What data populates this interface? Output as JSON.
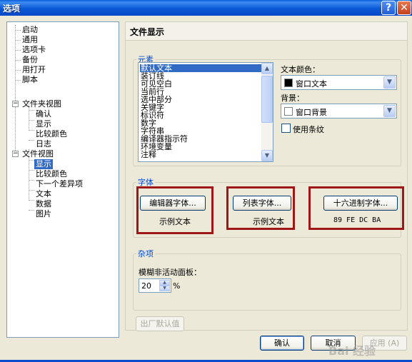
{
  "window": {
    "title": "选项",
    "help_glyph": "?",
    "close_glyph": "✕"
  },
  "tree": {
    "items": [
      {
        "label": "启动"
      },
      {
        "label": "通用"
      },
      {
        "label": "选项卡"
      },
      {
        "label": "备份"
      },
      {
        "label": "用打开"
      },
      {
        "label": "脚本"
      },
      {
        "label": "文件夹视图"
      },
      {
        "label": "确认"
      },
      {
        "label": "显示"
      },
      {
        "label": "比较颜色"
      },
      {
        "label": "日志"
      },
      {
        "label": "文件视图"
      },
      {
        "label": "显示"
      },
      {
        "label": "比较颜色"
      },
      {
        "label": "下一个差异项"
      },
      {
        "label": "文本"
      },
      {
        "label": "数据"
      },
      {
        "label": "图片"
      }
    ],
    "selected_index": 12,
    "expander_glyph": "−"
  },
  "panel": {
    "title": "文件显示"
  },
  "elements_group": {
    "legend": "元素",
    "list_items": [
      "默认文本",
      "装订线",
      "可见空白",
      "当前行",
      "选中部分",
      "关键字",
      "标识符",
      "数字",
      "字符串",
      "编译器指示符",
      "环境变量",
      "注释"
    ],
    "selected_index": 0,
    "text_color_label": "文本颜色：",
    "text_color_value": "窗口文本",
    "text_color_swatch": "#000000",
    "background_label": "背景：",
    "background_value": "窗口背景",
    "background_swatch": "#ffffff",
    "stripes_label": "使用条纹",
    "stripes_checked": false
  },
  "font_group": {
    "legend": "字体",
    "editor_font_button": "编辑器字体...",
    "editor_sample": "示例文本",
    "list_font_button": "列表字体...",
    "list_sample": "示例文本",
    "hex_font_button": "十六进制字体...",
    "hex_sample": "89 FE DC BA"
  },
  "misc_group": {
    "legend": "杂项",
    "fade_label": "模糊非活动面板：",
    "fade_value": "20",
    "fade_unit": "%"
  },
  "factory_defaults_button": "出厂默认值",
  "footer": {
    "ok": "确认",
    "cancel": "取消",
    "apply": "应用 (A)"
  },
  "watermark": "Bai 经验",
  "colors": {
    "highlight": "#316ac5",
    "annotation_red": "#a01717",
    "group_legend": "#0046d5"
  },
  "icons": {
    "scroll_up": "▲",
    "scroll_down": "▼",
    "combo_arrow": "▼",
    "spin_up": "▲",
    "spin_down": "▼"
  }
}
